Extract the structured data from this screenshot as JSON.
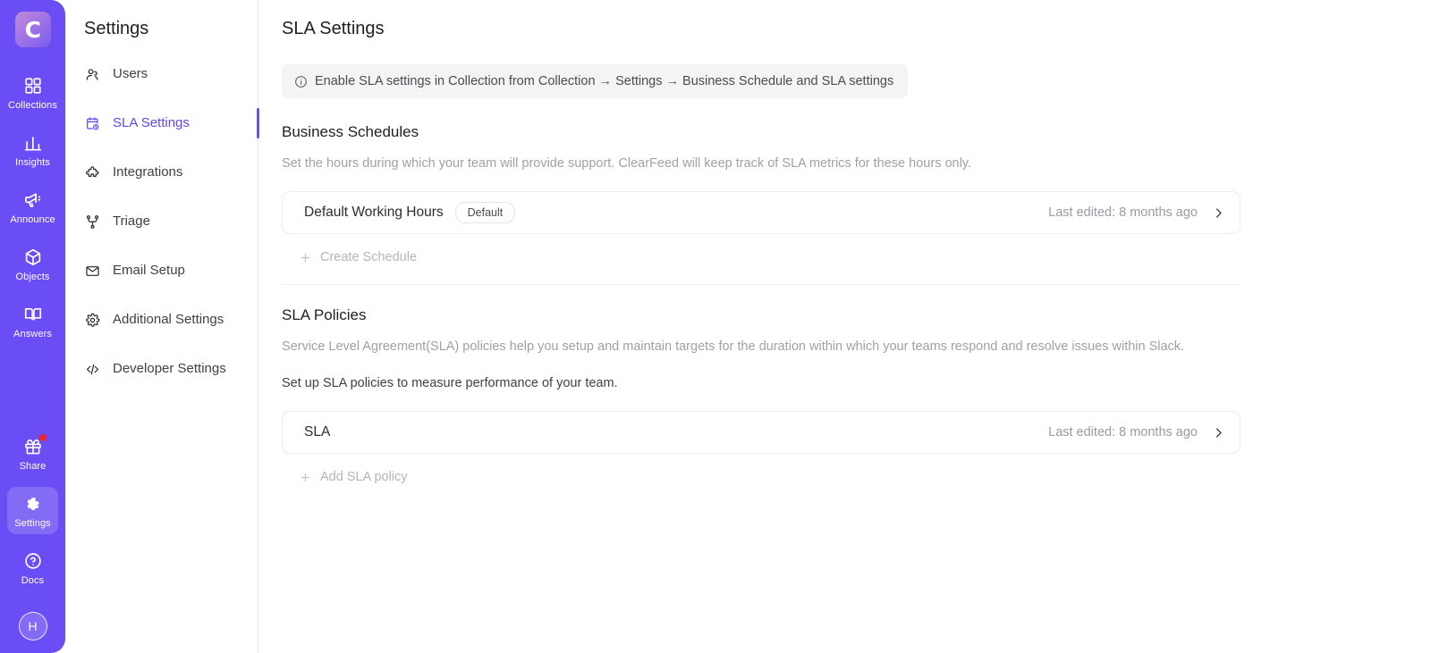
{
  "rail": {
    "logo_letter": "C",
    "items": [
      {
        "label": "Collections",
        "icon": "grid-icon",
        "active": false,
        "badge": false
      },
      {
        "label": "Insights",
        "icon": "bar-chart-icon",
        "active": false,
        "badge": false
      },
      {
        "label": "Announce",
        "icon": "megaphone-icon",
        "active": false,
        "badge": false
      },
      {
        "label": "Objects",
        "icon": "cube-icon",
        "active": false,
        "badge": false
      },
      {
        "label": "Answers",
        "icon": "book-icon",
        "active": false,
        "badge": false
      }
    ],
    "bottom_items": [
      {
        "label": "Share",
        "icon": "gift-icon",
        "active": false,
        "badge": true
      },
      {
        "label": "Settings",
        "icon": "gear-icon",
        "active": true,
        "badge": false
      },
      {
        "label": "Docs",
        "icon": "question-circle-icon",
        "active": false,
        "badge": false
      }
    ],
    "avatar_initial": "H",
    "accent_color": "#6a4df5"
  },
  "settings_nav": {
    "title": "Settings",
    "items": [
      {
        "label": "Users",
        "icon": "users-icon",
        "active": false
      },
      {
        "label": "SLA Settings",
        "icon": "calendar-clock-icon",
        "active": true
      },
      {
        "label": "Integrations",
        "icon": "puzzle-icon",
        "active": false
      },
      {
        "label": "Triage",
        "icon": "git-merge-icon",
        "active": false
      },
      {
        "label": "Email Setup",
        "icon": "mail-icon",
        "active": false
      },
      {
        "label": "Additional Settings",
        "icon": "gear-icon",
        "active": false
      },
      {
        "label": "Developer Settings",
        "icon": "code-icon",
        "active": false
      }
    ],
    "active_color": "#6146f0"
  },
  "main": {
    "page_title": "SLA Settings",
    "info_banner": {
      "icon": "info-circle-icon",
      "text": "Enable SLA settings in Collection from Collection → Settings → Business Schedule and SLA settings"
    },
    "business_schedules": {
      "title": "Business Schedules",
      "description": "Set the hours during which your team will provide support. ClearFeed will keep track of SLA metrics for these hours only.",
      "rows": [
        {
          "name": "Default Working Hours",
          "badge": "Default",
          "meta": "Last edited: 8 months ago",
          "chevron": "chevron-right-icon"
        }
      ],
      "add_label": "Create Schedule"
    },
    "sla_policies": {
      "title": "SLA Policies",
      "description": "Service Level Agreement(SLA) policies help you setup and maintain targets for the duration within which your teams respond and resolve issues within Slack.",
      "subdescription": "Set up SLA policies to measure performance of your team.",
      "rows": [
        {
          "name": "SLA",
          "badge": "",
          "meta": "Last edited: 8 months ago",
          "chevron": "chevron-right-icon"
        }
      ],
      "add_label": "Add SLA policy"
    }
  }
}
